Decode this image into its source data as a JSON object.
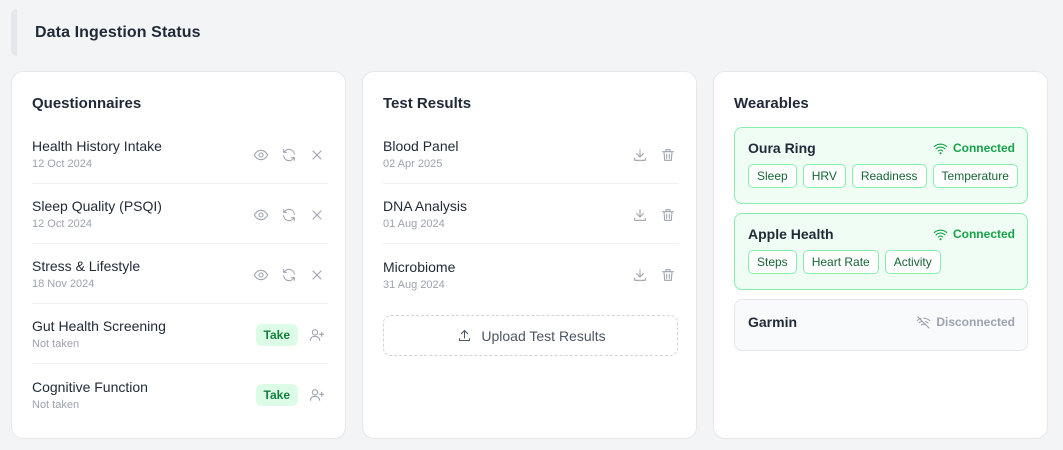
{
  "page": {
    "title": "Data Ingestion Status"
  },
  "questionnaires": {
    "title": "Questionnaires",
    "items": [
      {
        "name": "Health History Intake",
        "date": "12 Oct 2024",
        "status": "done"
      },
      {
        "name": "Sleep Quality (PSQI)",
        "date": "12 Oct 2024",
        "status": "done"
      },
      {
        "name": "Stress & Lifestyle",
        "date": "18 Nov 2024",
        "status": "done"
      },
      {
        "name": "Gut Health Screening",
        "date": "Not taken",
        "status": "pending",
        "action_label": "Take"
      },
      {
        "name": "Cognitive Function",
        "date": "Not taken",
        "status": "pending",
        "action_label": "Take"
      }
    ]
  },
  "test_results": {
    "title": "Test Results",
    "items": [
      {
        "name": "Blood Panel",
        "date": "02 Apr 2025"
      },
      {
        "name": "DNA Analysis",
        "date": "01 Aug 2024"
      },
      {
        "name": "Microbiome",
        "date": "31 Aug 2024"
      }
    ],
    "upload_label": "Upload Test Results"
  },
  "wearables": {
    "title": "Wearables",
    "items": [
      {
        "name": "Oura Ring",
        "status": "Connected",
        "tags": [
          "Sleep",
          "HRV",
          "Readiness",
          "Temperature"
        ]
      },
      {
        "name": "Apple Health",
        "status": "Connected",
        "tags": [
          "Steps",
          "Heart Rate",
          "Activity"
        ]
      },
      {
        "name": "Garmin",
        "status": "Disconnected",
        "tags": []
      }
    ]
  },
  "icons": {
    "view": "eye-icon",
    "refresh": "refresh-icon",
    "remove": "close-icon",
    "assign": "user-plus-icon",
    "download": "download-icon",
    "delete": "trash-icon",
    "upload": "upload-icon",
    "connected": "wifi-icon",
    "disconnected": "wifi-off-icon"
  },
  "colors": {
    "accent_green": "#16a34a",
    "connected_bg": "#f0fdf4",
    "connected_border": "#86efac",
    "muted": "#9ca3af"
  }
}
